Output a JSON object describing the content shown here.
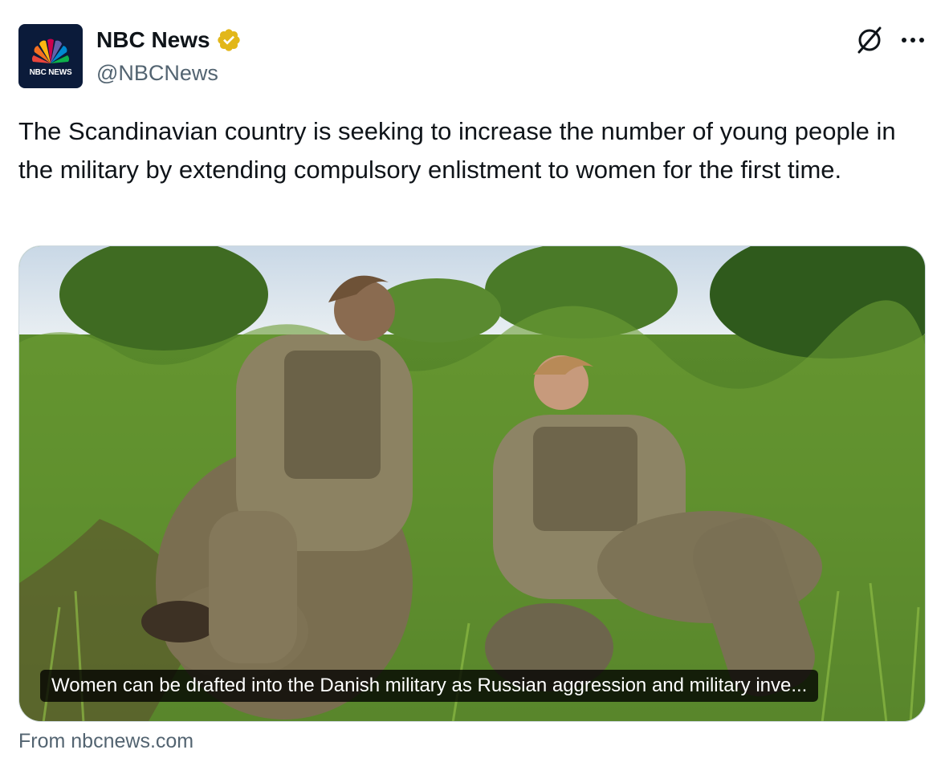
{
  "author": {
    "display_name": "NBC News",
    "handle": "@NBCNews",
    "avatar_text": "NBC NEWS",
    "verified_badge_color": "#e2b719",
    "avatar_bg": "#0b1b3a"
  },
  "icons": {
    "grok": "slashed-circle-icon",
    "more": "more-dots-icon"
  },
  "tweet": {
    "text": "The Scandinavian country is seeking to increase the number of young people in the military by extending compulsory enlistment to women for the first time."
  },
  "card": {
    "caption": "Women can be drafted into the Danish military as Russian aggression and military inve...",
    "image_alt": "Two female soldiers in camouflage uniforms sitting in tall grass",
    "source": "From nbcnews.com"
  },
  "colors": {
    "text_primary": "#0f1419",
    "text_secondary": "#536471",
    "card_border": "#cfd9de"
  }
}
